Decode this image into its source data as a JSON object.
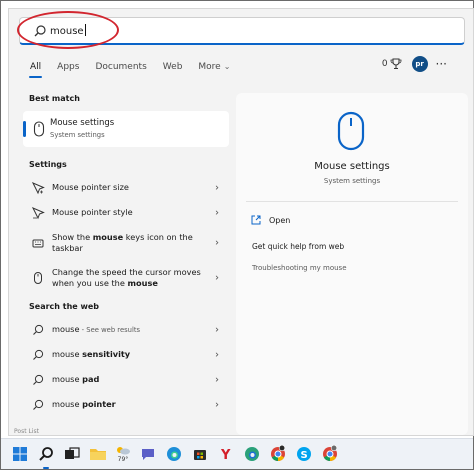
{
  "search": {
    "query": "mouse"
  },
  "tabs": [
    {
      "label": "All"
    },
    {
      "label": "Apps"
    },
    {
      "label": "Documents"
    },
    {
      "label": "Web"
    },
    {
      "label": "More"
    }
  ],
  "toolbar": {
    "rewards_count": "0",
    "avatar_initials": "pr"
  },
  "best_match": {
    "heading": "Best match",
    "title": "Mouse settings",
    "subtitle": "System settings"
  },
  "settings": {
    "heading": "Settings",
    "items": [
      {
        "label": "Mouse pointer size"
      },
      {
        "label": "Mouse pointer style"
      },
      {
        "before": "Show the ",
        "bold": "mouse",
        "after": " keys icon on the taskbar"
      },
      {
        "before": "Change the speed the cursor moves when you use the ",
        "bold": "mouse",
        "after": ""
      }
    ]
  },
  "web": {
    "heading": "Search the web",
    "items": [
      {
        "before": "mouse",
        "bold": "",
        "small": " - See web results"
      },
      {
        "before": "mouse ",
        "bold": "sensitivity",
        "small": ""
      },
      {
        "before": "mouse ",
        "bold": "pad",
        "small": ""
      },
      {
        "before": "mouse ",
        "bold": "pointer",
        "small": ""
      }
    ]
  },
  "detail": {
    "title": "Mouse settings",
    "subtitle": "System settings",
    "open_label": "Open",
    "help_label": "Get quick help from web",
    "trouble_label": "Troubleshooting my mouse"
  },
  "bottom_strip": {
    "text": "Post     List"
  },
  "taskbar": {
    "weather_temp": "79°"
  },
  "colors": {
    "accent": "#0a64c8",
    "annotation": "#d2262f"
  }
}
